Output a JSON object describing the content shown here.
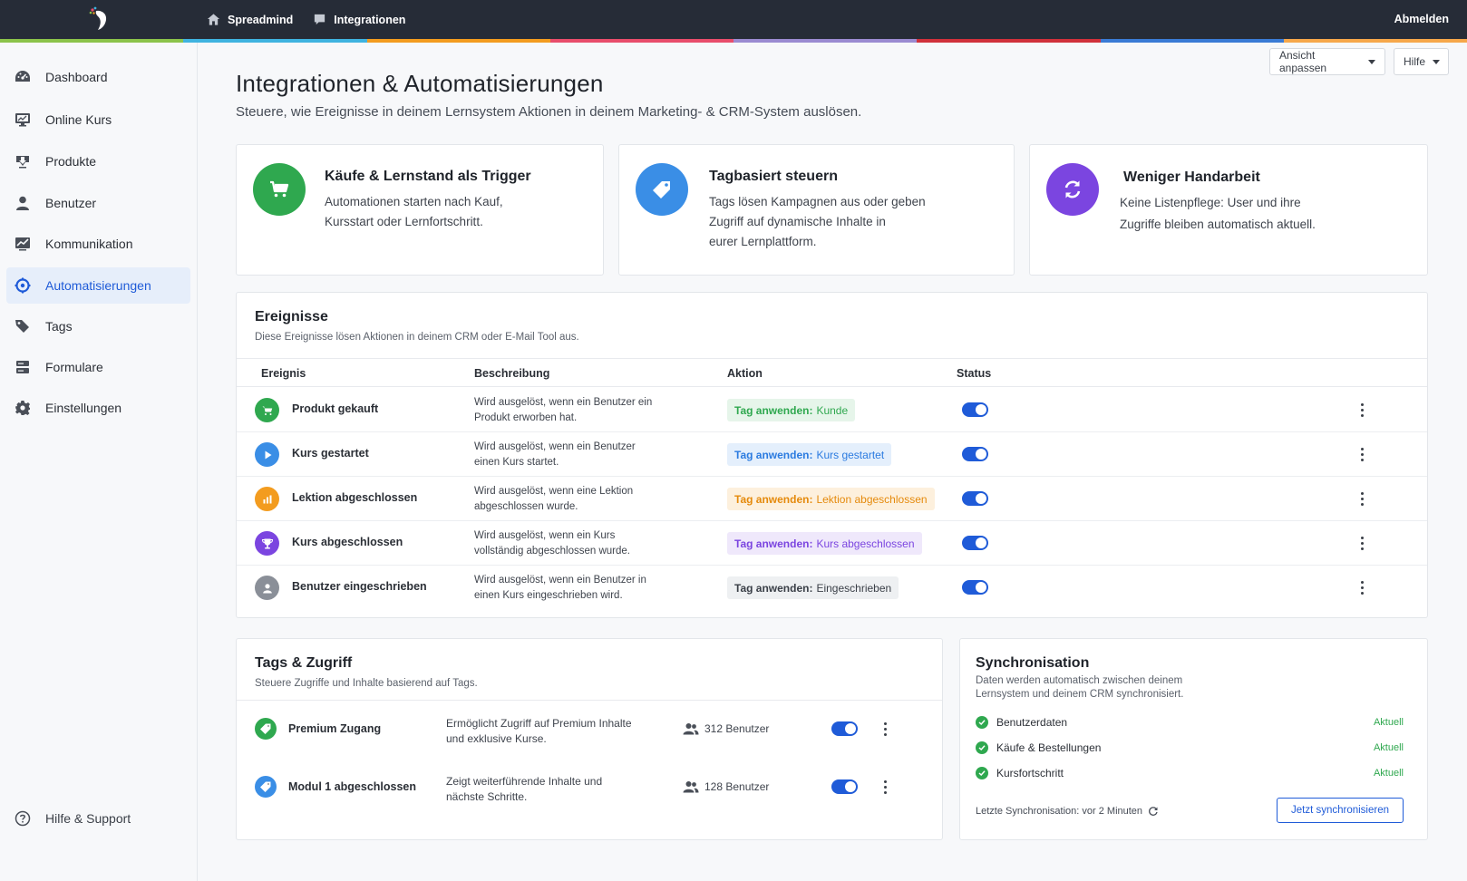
{
  "topbar": {
    "nav": [
      {
        "label": "Spreadmind",
        "icon": "home-icon"
      },
      {
        "label": "Integrationen",
        "icon": "chat-icon"
      }
    ],
    "logout": "Abmelden",
    "stripe_colors": [
      "#8bc34a",
      "#3fb3e0",
      "#f39c1f",
      "#e84d6b",
      "#9b8bd1",
      "#d0313b",
      "#3a7bd5",
      "#f6a74a"
    ]
  },
  "sidebar": {
    "items": [
      {
        "label": "Dashboard",
        "icon": "dashboard-icon"
      },
      {
        "label": "Online Kurs",
        "icon": "monitor-icon"
      },
      {
        "label": "Produkte",
        "icon": "download-icon"
      },
      {
        "label": "Benutzer",
        "icon": "user-icon"
      },
      {
        "label": "Kommunikation",
        "icon": "chart-icon"
      },
      {
        "label": "Automatisierungen",
        "icon": "gear-cycle-icon",
        "active": true
      },
      {
        "label": "Tags",
        "icon": "tags-icon"
      },
      {
        "label": "Formulare",
        "icon": "form-icon"
      },
      {
        "label": "Einstellungen",
        "icon": "gear-icon"
      }
    ],
    "help": "Hilfe & Support"
  },
  "header": {
    "title": "Integrationen & Automatisierungen",
    "subtitle": "Steuere, wie Ereignisse in deinem Lernsystem Aktionen in deinem Marketing- & CRM-System auslösen.",
    "view_button": "Ansicht anpassen",
    "help_button": "Hilfe"
  },
  "features": [
    {
      "title": "Käufe & Lernstand als Trigger",
      "text_1": "Automationen starten nach Kauf,",
      "text_2": "Kursstart oder Lernfortschritt.",
      "icon": "cart-icon",
      "color": "#2fa84f"
    },
    {
      "title": "Tagbasiert steuern",
      "text_1": "Tags lösen Kampagnen aus oder geben",
      "text_2": "Zugriff auf dynamische Inhalte in",
      "text_3": "eurer Lernplattform.",
      "icon": "tag-icon",
      "color": "#3a8ee6"
    },
    {
      "title": "Weniger Handarbeit",
      "text_1": "Keine Listenpflege: User und ihre",
      "text_2": "Zugriffe bleiben automatisch aktuell.",
      "icon": "sync-icon",
      "color": "#7b45e0"
    }
  ],
  "events": {
    "title": "Ereignisse",
    "subtitle": "Diese Ereignisse lösen Aktionen in deinem CRM oder E-Mail Tool aus.",
    "columns": [
      "Ereignis",
      "Beschreibung",
      "Aktion",
      "Status"
    ],
    "rows": [
      {
        "name": "Produkt gekauft",
        "desc_1": "Wird ausgelöst, wenn ein Benutzer ein",
        "desc_2": "Produkt erworben hat.",
        "action_prefix": "Tag anwenden:",
        "action_value": "Kunde",
        "icon": "cart-icon",
        "icon_color": "#2fa84f",
        "badge_bg": "#e6f5ea",
        "badge_color": "#2fa84f",
        "enabled": true
      },
      {
        "name": "Kurs gestartet",
        "desc_1": "Wird ausgelöst, wenn ein Benutzer",
        "desc_2": "einen Kurs startet.",
        "action_prefix": "Tag anwenden:",
        "action_value": "Kurs gestartet",
        "icon": "play-icon",
        "icon_color": "#3a8ee6",
        "badge_bg": "#e4effc",
        "badge_color": "#2b7be0",
        "enabled": true
      },
      {
        "name": "Lektion abgeschlossen",
        "desc_1": "Wird ausgelöst, wenn eine Lektion",
        "desc_2": "abgeschlossen wurde.",
        "action_prefix": "Tag anwenden:",
        "action_value": "Lektion abgeschlossen",
        "icon": "bar-chart-icon",
        "icon_color": "#f39c1f",
        "badge_bg": "#fdf0dd",
        "badge_color": "#e58a0c",
        "enabled": true
      },
      {
        "name": "Kurs abgeschlossen",
        "desc_1": "Wird ausgelöst, wenn ein Kurs",
        "desc_2": "vollständig abgeschlossen wurde.",
        "action_prefix": "Tag anwenden:",
        "action_value": "Kurs abgeschlossen",
        "icon": "trophy-icon",
        "icon_color": "#7b45e0",
        "badge_bg": "#efe8fb",
        "badge_color": "#7b45e0",
        "enabled": true
      },
      {
        "name": "Benutzer eingeschrieben",
        "desc_1": "Wird ausgelöst, wenn ein Benutzer in",
        "desc_2": "einen Kurs eingeschrieben wird.",
        "action_prefix": "Tag anwenden:",
        "action_value": "Eingeschrieben",
        "icon": "user-icon",
        "icon_color": "#8a8f98",
        "badge_bg": "#eef0f2",
        "badge_color": "#3a3f47",
        "enabled": true
      }
    ]
  },
  "tags_access": {
    "title": "Tags & Zugriff",
    "subtitle": "Steuere Zugriffe und Inhalte basierend auf Tags.",
    "rows": [
      {
        "name": "Premium Zugang",
        "desc_1": "Ermöglicht Zugriff auf Premium Inhalte",
        "desc_2": "und exklusive Kurse.",
        "users": "312 Benutzer",
        "icon": "tag-icon",
        "icon_color": "#2fa84f",
        "enabled": true
      },
      {
        "name": "Modul 1 abgeschlossen",
        "desc_1": "Zeigt weiterführende Inhalte und",
        "desc_2": "nächste Schritte.",
        "users": "128 Benutzer",
        "icon": "tag-icon",
        "icon_color": "#3a8ee6",
        "enabled": true
      }
    ]
  },
  "sync": {
    "title": "Synchronisation",
    "subtitle_1": "Daten werden automatisch zwischen deinem",
    "subtitle_2": "Lernsystem und deinem CRM synchronisiert.",
    "items": [
      {
        "label": "Benutzerdaten",
        "status": "Aktuell"
      },
      {
        "label": "Käufe & Bestellungen",
        "status": "Aktuell"
      },
      {
        "label": "Kursfortschritt",
        "status": "Aktuell"
      }
    ],
    "last_sync": "Letzte Synchronisation: vor 2 Minuten",
    "button": "Jetzt synchronisieren"
  }
}
